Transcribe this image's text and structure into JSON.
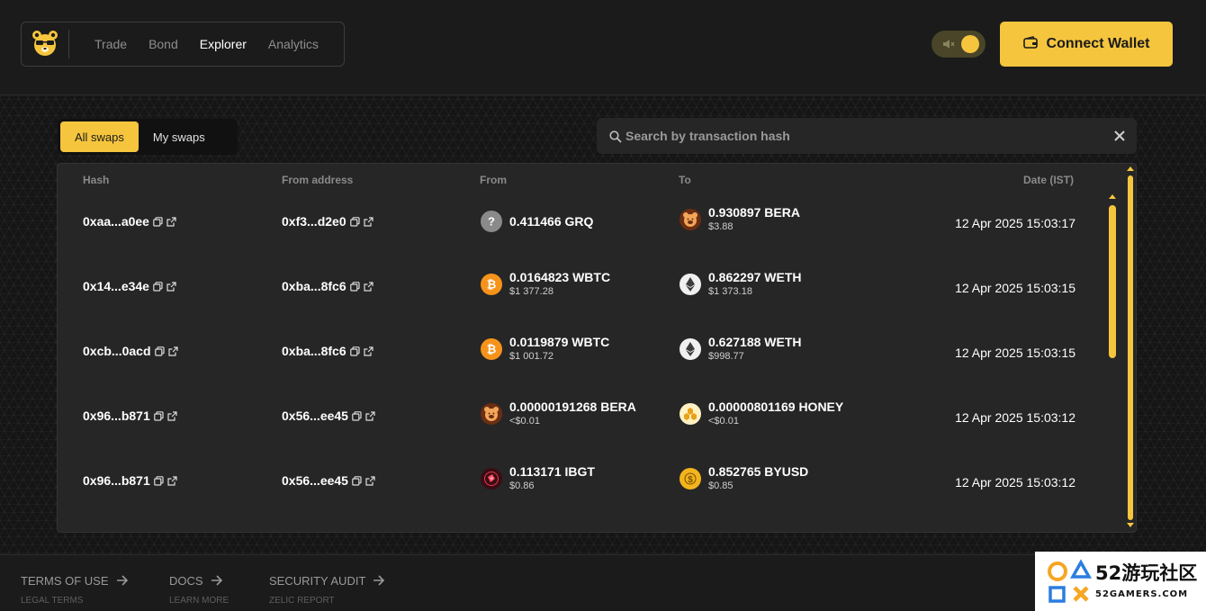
{
  "nav": {
    "items": [
      {
        "label": "Trade",
        "active": false
      },
      {
        "label": "Bond",
        "active": false
      },
      {
        "label": "Explorer",
        "active": true
      },
      {
        "label": "Analytics",
        "active": false
      }
    ]
  },
  "header": {
    "connect_label": "Connect Wallet"
  },
  "tabs": {
    "all": "All swaps",
    "mine": "My swaps"
  },
  "search": {
    "placeholder": "Search by transaction hash"
  },
  "table": {
    "columns": [
      "Hash",
      "From address",
      "From",
      "To",
      "Date (IST)"
    ],
    "rows": [
      {
        "hash": "0xaa...a0ee",
        "from_address": "0xf3...d2e0",
        "from": {
          "amount": "0.411466 GRQ",
          "usd": "",
          "icon": "unknown-token-icon"
        },
        "to": {
          "amount": "0.930897 BERA",
          "usd": "$3.88",
          "icon": "bera-icon"
        },
        "date": "12 Apr 2025 15:03:17"
      },
      {
        "hash": "0x14...e34e",
        "from_address": "0xba...8fc6",
        "from": {
          "amount": "0.0164823 WBTC",
          "usd": "$1 377.28",
          "icon": "wbtc-icon"
        },
        "to": {
          "amount": "0.862297 WETH",
          "usd": "$1 373.18",
          "icon": "weth-icon"
        },
        "date": "12 Apr 2025 15:03:15"
      },
      {
        "hash": "0xcb...0acd",
        "from_address": "0xba...8fc6",
        "from": {
          "amount": "0.0119879 WBTC",
          "usd": "$1 001.72",
          "icon": "wbtc-icon"
        },
        "to": {
          "amount": "0.627188 WETH",
          "usd": "$998.77",
          "icon": "weth-icon"
        },
        "date": "12 Apr 2025 15:03:15"
      },
      {
        "hash": "0x96...b871",
        "from_address": "0x56...ee45",
        "from": {
          "amount": "0.00000191268 BERA",
          "usd": "<$0.01",
          "icon": "bera-icon"
        },
        "to": {
          "amount": "0.00000801169 HONEY",
          "usd": "<$0.01",
          "icon": "honey-icon"
        },
        "date": "12 Apr 2025 15:03:12"
      },
      {
        "hash": "0x96...b871",
        "from_address": "0x56...ee45",
        "from": {
          "amount": "0.113171 IBGT",
          "usd": "$0.86",
          "icon": "ibgt-icon"
        },
        "to": {
          "amount": "0.852765 BYUSD",
          "usd": "$0.85",
          "icon": "byusd-icon"
        },
        "date": "12 Apr 2025 15:03:12"
      }
    ]
  },
  "footer": {
    "links": [
      {
        "title": "TERMS OF USE",
        "sub": "LEGAL TERMS"
      },
      {
        "title": "DOCS",
        "sub": "LEARN MORE"
      },
      {
        "title": "SECURITY AUDIT",
        "sub": "ZELIC REPORT"
      }
    ]
  },
  "watermark": {
    "text": "52游玩社区",
    "sub": "52GAMERS.COM"
  },
  "colors": {
    "accent": "#f5c53d",
    "background": "#1b1b1b",
    "panel": "#262626"
  }
}
